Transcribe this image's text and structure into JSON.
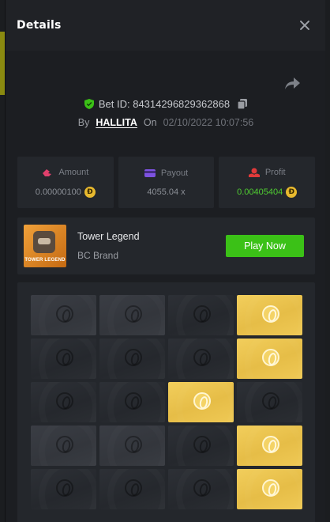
{
  "header": {
    "title": "Details"
  },
  "bet": {
    "id_label": "Bet ID: 84314296829362868",
    "by_label": "By",
    "user": "HALLITA",
    "on_label": "On",
    "date": "02/10/2022 10:07:56"
  },
  "stats": {
    "amount": {
      "label": "Amount",
      "value": "0.00000100"
    },
    "payout": {
      "label": "Payout",
      "value": "4055.04 x"
    },
    "profit": {
      "label": "Profit",
      "value": "0.00405404"
    }
  },
  "game": {
    "name": "Tower Legend",
    "brand": "BC Brand",
    "thumb_text": "TOWER LEGEND",
    "play_label": "Play Now"
  },
  "board": {
    "rows": [
      [
        "lite",
        "lite",
        "dark",
        "gold"
      ],
      [
        "dark",
        "dark",
        "dark",
        "gold"
      ],
      [
        "dark",
        "dark",
        "gold",
        "dark"
      ],
      [
        "lite",
        "lite",
        "dark",
        "gold"
      ],
      [
        "dark",
        "dark",
        "dark",
        "gold"
      ]
    ]
  },
  "coin_symbol": "Ð",
  "colors": {
    "accent_green": "#3bc117",
    "profit_green": "#4fcc31",
    "gold": "#e6bd47"
  }
}
